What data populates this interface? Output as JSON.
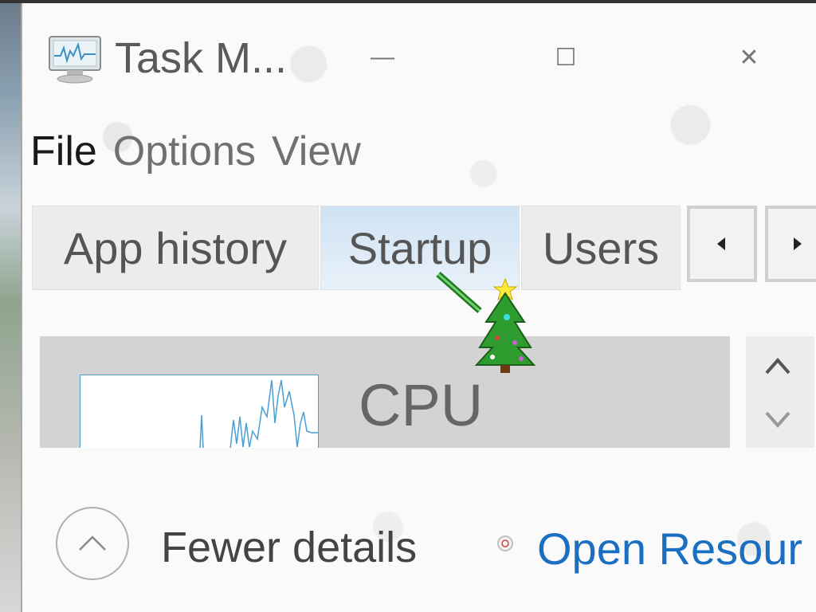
{
  "window": {
    "title": "Task M...",
    "icon": "task-manager-icon",
    "controls": {
      "minimize": "—",
      "maximize": "☐",
      "close": "✕"
    }
  },
  "menubar": {
    "items": [
      {
        "label": "File"
      },
      {
        "label": "Options"
      },
      {
        "label": "View"
      }
    ]
  },
  "tabs": {
    "items": [
      {
        "label": "App history",
        "active": false
      },
      {
        "label": "Startup",
        "active": true
      },
      {
        "label": "Users",
        "active": false
      }
    ],
    "scroll_left_icon": "chevron-left-icon",
    "scroll_right_icon": "chevron-right-icon"
  },
  "overlay": {
    "icon": "christmas-tree-icon"
  },
  "performance": {
    "cpu_label": "CPU",
    "scroll_up_icon": "chevron-up-icon",
    "scroll_down_icon": "chevron-down-icon"
  },
  "footer": {
    "fewer_details_label": "Fewer details",
    "open_resource_monitor_label": "Open Resour",
    "link_color": "#1a6fc1"
  },
  "colors": {
    "accent": "#4a9fd4",
    "active_tab": "#cfe2f3"
  }
}
